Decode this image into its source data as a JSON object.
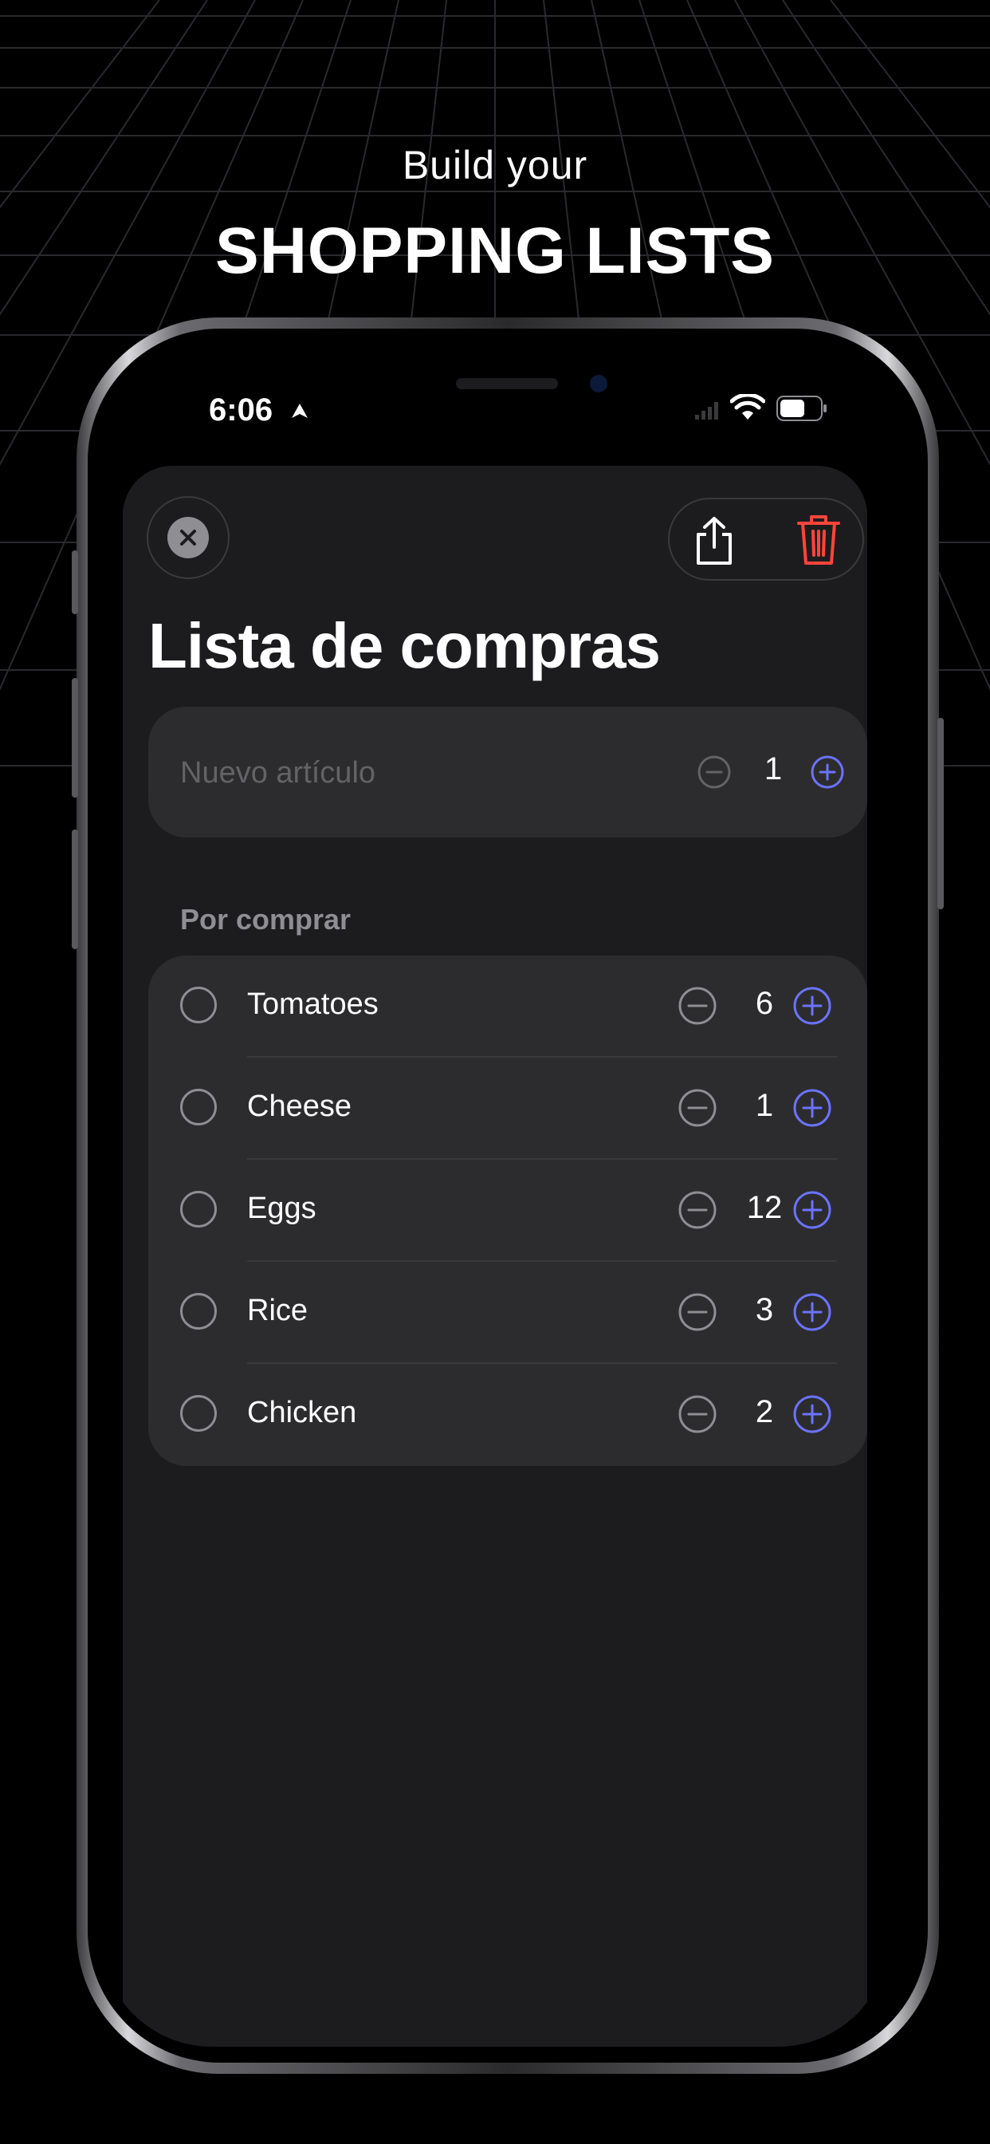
{
  "promo": {
    "subtitle": "Build your",
    "title": "SHOPPING LISTS"
  },
  "status_bar": {
    "time": "6:06"
  },
  "toolbar": {
    "close_icon": "close-icon",
    "share_icon": "share-icon",
    "delete_icon": "trash-icon"
  },
  "list": {
    "title": "Lista de compras",
    "new_item": {
      "placeholder": "Nuevo artículo",
      "quantity": "1"
    },
    "section_title": "Por comprar",
    "items": [
      {
        "name": "Tomatoes",
        "quantity": "6"
      },
      {
        "name": "Cheese",
        "quantity": "1"
      },
      {
        "name": "Eggs",
        "quantity": "12"
      },
      {
        "name": "Rice",
        "quantity": "3"
      },
      {
        "name": "Chicken",
        "quantity": "2"
      }
    ]
  },
  "colors": {
    "accent": "#6b73ff",
    "delete": "#ff453a",
    "sheet_bg": "#1c1c1e",
    "card_bg": "#2c2c2e",
    "secondary_text": "#8e8e93"
  }
}
